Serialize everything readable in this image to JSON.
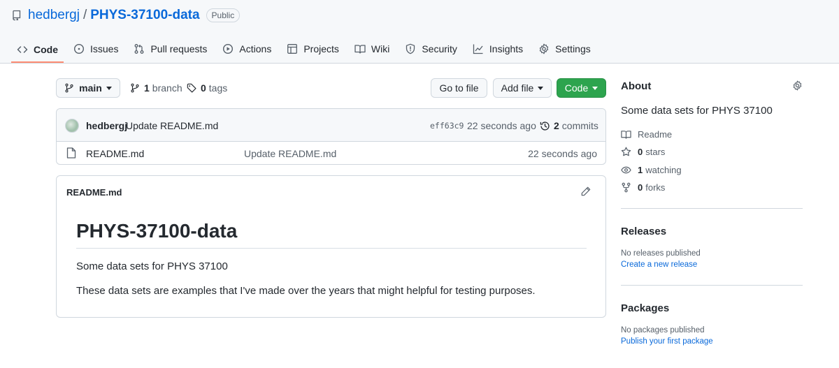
{
  "repo": {
    "owner": "hedbergj",
    "separator": "/",
    "name": "PHYS-37100-data",
    "visibility": "Public"
  },
  "tabs": [
    {
      "label": "Code",
      "icon": "code-icon",
      "selected": true
    },
    {
      "label": "Issues",
      "icon": "issue-icon"
    },
    {
      "label": "Pull requests",
      "icon": "pull-request-icon"
    },
    {
      "label": "Actions",
      "icon": "play-icon"
    },
    {
      "label": "Projects",
      "icon": "table-icon"
    },
    {
      "label": "Wiki",
      "icon": "book-icon"
    },
    {
      "label": "Security",
      "icon": "shield-icon"
    },
    {
      "label": "Insights",
      "icon": "graph-icon"
    },
    {
      "label": "Settings",
      "icon": "gear-icon"
    }
  ],
  "toolbar": {
    "branch": "main",
    "branch_count": "1",
    "branch_label": "branch",
    "tag_count": "0",
    "tag_label": "tags",
    "go_to_file": "Go to file",
    "add_file": "Add file",
    "code": "Code"
  },
  "commit": {
    "author": "hedbergj",
    "message": "Update README.md",
    "sha": "eff63c9",
    "time": "22 seconds ago",
    "count": "2",
    "count_label": "commits"
  },
  "files": [
    {
      "name": "README.md",
      "message": "Update README.md",
      "time": "22 seconds ago",
      "icon": "file-icon"
    }
  ],
  "readme": {
    "filename": "README.md",
    "heading": "PHYS-37100-data",
    "paragraph1": "Some data sets for PHYS 37100",
    "paragraph2": "These data sets are examples that I've made over the years that might helpful for testing purposes."
  },
  "about": {
    "title": "About",
    "description": "Some data sets for PHYS 37100",
    "readme_label": "Readme",
    "stars_count": "0",
    "stars_label": "stars",
    "watching_count": "1",
    "watching_label": "watching",
    "forks_count": "0",
    "forks_label": "forks"
  },
  "releases": {
    "title": "Releases",
    "empty": "No releases published",
    "link": "Create a new release"
  },
  "packages": {
    "title": "Packages",
    "empty": "No packages published",
    "link": "Publish your first package"
  },
  "colors": {
    "link": "#0969da",
    "green_button": "#2da44e",
    "tab_underline": "#fd8c73",
    "muted": "#57606a"
  }
}
